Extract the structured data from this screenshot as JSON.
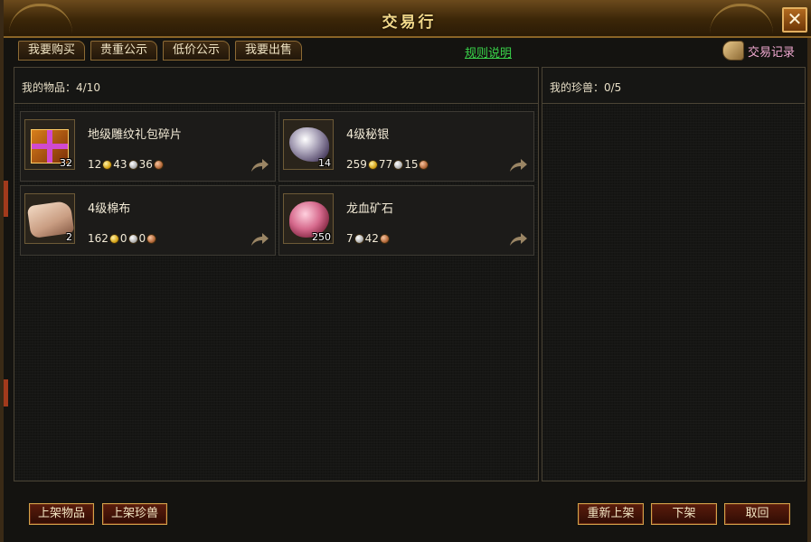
{
  "window": {
    "title": "交易行",
    "close_symbol": "✕"
  },
  "tabs": [
    {
      "label": "我要购买"
    },
    {
      "label": "贵重公示"
    },
    {
      "label": "低价公示"
    },
    {
      "label": "我要出售"
    }
  ],
  "rules_link": "规则说明",
  "trade_log": {
    "label": "交易记录",
    "icon": "scroll-icon"
  },
  "items_panel": {
    "header": "我的物品：4/10"
  },
  "pets_panel": {
    "header": "我的珍兽：0/5"
  },
  "items": [
    {
      "name": "地级雕纹礼包碎片",
      "qty": "32",
      "icon": "gift-box-icon",
      "price": {
        "gold": "12",
        "silver": "43",
        "copper": "36"
      }
    },
    {
      "name": "4级秘银",
      "qty": "14",
      "icon": "mithril-ore-icon",
      "price": {
        "gold": "259",
        "silver": "77",
        "copper": "15"
      }
    },
    {
      "name": "4级棉布",
      "qty": "2",
      "icon": "cotton-cloth-icon",
      "price": {
        "gold": "162",
        "silver": "0",
        "copper": "0"
      }
    },
    {
      "name": "龙血矿石",
      "qty": "250",
      "icon": "dragonblood-ore-icon",
      "price": {
        "silver": "7",
        "copper": "42"
      }
    }
  ],
  "buttons": {
    "list_item": "上架物品",
    "list_pet": "上架珍兽",
    "relist": "重新上架",
    "delist": "下架",
    "cancel": "取回"
  },
  "colors": {
    "title_gold": "#f3d98a",
    "link_green": "#39d44a",
    "trade_log_pink": "#f0a8d0",
    "button_border": "#d3a24a"
  }
}
